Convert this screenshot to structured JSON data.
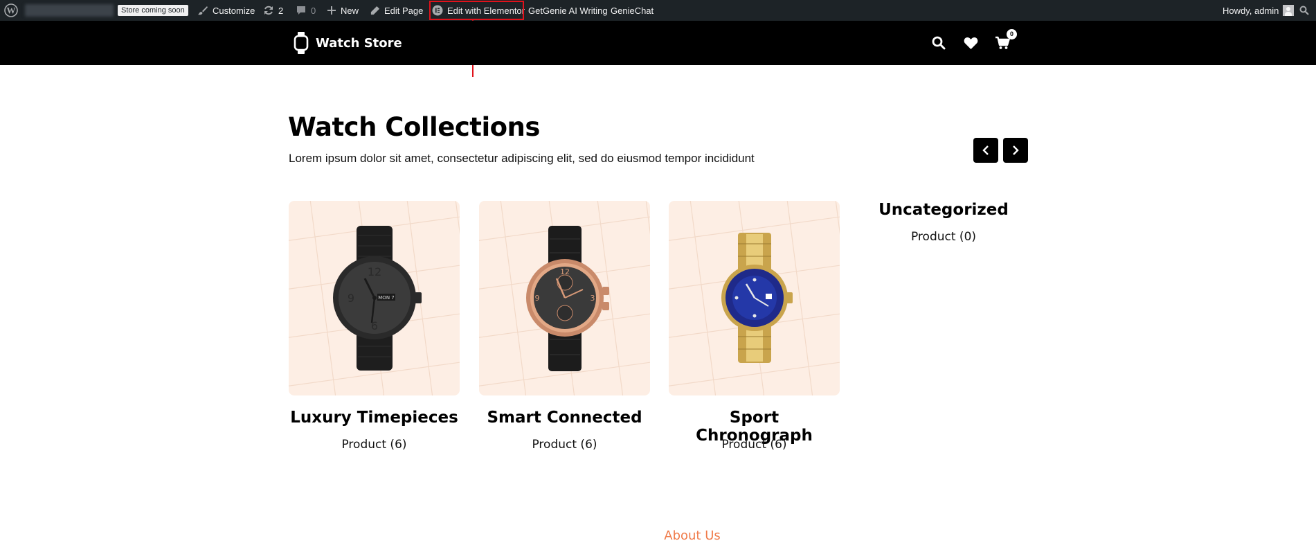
{
  "admin_bar": {
    "coming_soon_badge": "Store coming soon",
    "customize": "Customize",
    "updates_count": "2",
    "comments_count": "0",
    "new": "New",
    "edit_page": "Edit Page",
    "edit_elementor": "Edit with Elementor",
    "getgenie": "GetGenie AI Writing",
    "geniechat": "GenieChat",
    "howdy": "Howdy, admin"
  },
  "header": {
    "logo_text": "Watch Store",
    "cart_count": "0",
    "icons": [
      "watch-icon",
      "search-icon",
      "heart-icon",
      "cart-icon"
    ]
  },
  "section": {
    "title": "Watch Collections",
    "subtitle": "Lorem ipsum dolor sit amet, consectetur adipiscing elit, sed do eiusmod tempor incididunt"
  },
  "collections": [
    {
      "name": "Luxury Timepieces",
      "count": "Product (6)"
    },
    {
      "name": "Smart Connected",
      "count": "Product (6)"
    },
    {
      "name": "Sport Chronograph",
      "count": "Product (6)"
    },
    {
      "name": "Uncategorized",
      "count": "Product (0)"
    }
  ],
  "footer": {
    "about": "About Us"
  },
  "colors": {
    "admin_bar": "#1d2327",
    "header": "#000000",
    "card_bg": "#fdeee4",
    "accent": "#f07b4a",
    "annotation": "#e0121b"
  }
}
